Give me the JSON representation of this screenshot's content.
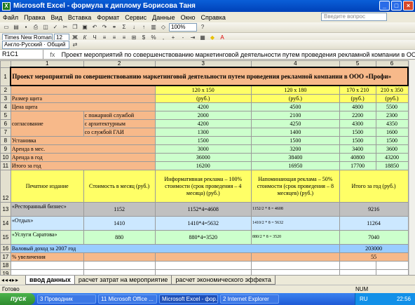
{
  "window": {
    "title": "Microsoft Excel - формула к диплому Борисова Таня"
  },
  "menu": {
    "items": [
      "Файл",
      "Правка",
      "Вид",
      "Вставка",
      "Формат",
      "Сервис",
      "Данные",
      "Окно",
      "Справка"
    ],
    "ask_placeholder": "Введите вопрос"
  },
  "toolbar": {
    "font": "Times New Roman",
    "size": "12",
    "zoom": "100%",
    "lang": "Англо-Русский · Общий"
  },
  "formula": {
    "cell": "R1C1",
    "fx": "fx",
    "content": "Проект мероприятий по совершенствованию маркетинговой деятельности путем проведения рекламной компании в ООО «Профи»"
  },
  "grid": {
    "col_headers": [
      "1",
      "2",
      "3",
      "4",
      "5",
      "6"
    ],
    "row_headers": [
      "1",
      "2",
      "3",
      "4",
      "5",
      "6",
      "7",
      "8",
      "9",
      "10",
      "11",
      "12",
      "13",
      "14",
      "15",
      "16",
      "17",
      "18",
      "19"
    ],
    "r1": "Проект мероприятий по совершенствованию маркетинговой деятельности путем проведения рекламной компании в ООО «Профи»",
    "r2": [
      "120 х 150",
      "120 х 180",
      "170 х 210",
      "210 х 350"
    ],
    "r3_label": "Размер щита",
    "r3": [
      "(руб.)",
      "(руб.)",
      "(руб.)",
      "(руб.)"
    ],
    "r4_label": "Цена щита",
    "r4": [
      "4200",
      "4500",
      "4800",
      "5500"
    ],
    "r5_sub": "с пожарной службой",
    "r5": [
      "2000",
      "2100",
      "2200",
      "2300"
    ],
    "r6_label": "согласование",
    "r6_sub": "с архитектурным",
    "r6": [
      "4200",
      "4250",
      "4300",
      "4350"
    ],
    "r7_sub": "со службой ГАИ",
    "r7": [
      "1300",
      "1400",
      "1500",
      "1600"
    ],
    "r8_label": "Установка",
    "r8": [
      "1500",
      "1500",
      "1500",
      "1500"
    ],
    "r9_label": "Аренда в мес.",
    "r9": [
      "3000",
      "3200",
      "3400",
      "3600"
    ],
    "r10_label": "Аренда в год",
    "r10": [
      "36000",
      "38400",
      "40800",
      "43200"
    ],
    "r11_label": "Итого за год",
    "r11": [
      "16200",
      "16950",
      "17700",
      "18850"
    ],
    "r12": [
      "Печатное издание",
      "Стоимость в месяц (руб.)",
      "Информативная реклама – 100% стоимости (срок проведения – 4 месяца) (руб.)",
      "Напоминающая реклама – 50% стоимости (срок проведения – 8 месяцев) (руб.)",
      "Итого за год (руб.)"
    ],
    "r13": [
      "«Ресторанный бизнес»",
      "1152",
      "1152*4=4608",
      "1152/2 * 8 = 4608",
      "9216"
    ],
    "r14": [
      "«Отдых»",
      "1410",
      "1410*4=5632",
      "1410/2 * 8 = 5632",
      "11264"
    ],
    "r15": [
      "«Услуги Саратова»",
      "880",
      "880*4=3520",
      "880/2 * 8 = 3520",
      "7040"
    ],
    "r16_label": "Валовый доход за 2007 год",
    "r16": "203000",
    "r17_label": "% увеличения",
    "r17": "55"
  },
  "tabs": [
    "ввод данных",
    "расчет затрат на мероприятие",
    "расчет экономического эффекта"
  ],
  "status": {
    "left": "Готово",
    "num": "NUM"
  },
  "taskbar": {
    "start": "пуск",
    "tasks": [
      "3 Проводник",
      "11 Microsoft Office ...",
      "Microsoft Excel - фор...",
      "2 Internet Explorer"
    ],
    "lang": "RU",
    "time": "22:56"
  }
}
